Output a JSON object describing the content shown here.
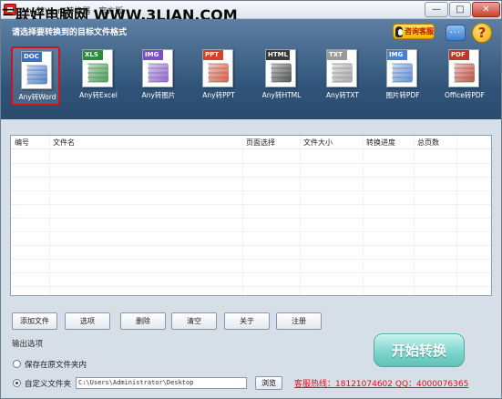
{
  "window": {
    "title": "Any转Word转换器 - 官方版",
    "watermark": "三联好电脑网 WWW.3LIAN.COM",
    "min_glyph": "—",
    "max_glyph": "□",
    "close_glyph": "✕"
  },
  "header": {
    "caption": "请选择要转换到的目标文件格式",
    "qq_label": "咨询客服",
    "chat_glyph": "···",
    "help_glyph": "?"
  },
  "formats": [
    {
      "tag": "DOC",
      "label": "Any转Word",
      "color": "#3b6fbf",
      "icon": "word-doc-icon",
      "selected": true
    },
    {
      "tag": "XLS",
      "label": "Any转Excel",
      "color": "#2e8b3a",
      "icon": "excel-chart-icon",
      "selected": false
    },
    {
      "tag": "IMG",
      "label": "Any转图片",
      "color": "#7f4fbf",
      "icon": "image-icon",
      "selected": false
    },
    {
      "tag": "PPT",
      "label": "Any转PPT",
      "color": "#d2442a",
      "icon": "ppt-slide-icon",
      "selected": false
    },
    {
      "tag": "HTML",
      "label": "Any转HTML",
      "color": "#3a3a3a",
      "icon": "globe-icon",
      "selected": false
    },
    {
      "tag": "TXT",
      "label": "Any转TXT",
      "color": "#9a9a9a",
      "icon": "text-doc-icon",
      "selected": false
    },
    {
      "tag": "IMG",
      "label": "图片转PDF",
      "color": "#4a7fc9",
      "icon": "image-to-pdf-icon",
      "selected": false
    },
    {
      "tag": "PDF",
      "label": "Office转PDF",
      "color": "#b83a2a",
      "icon": "pdf-icon",
      "selected": false
    }
  ],
  "table": {
    "columns": [
      "编号",
      "文件名",
      "页面选择",
      "文件大小",
      "转换进度",
      "总页数"
    ]
  },
  "buttons": {
    "add_file": "添加文件",
    "options": "选项",
    "delete": "删除",
    "clear": "清空",
    "about": "关于",
    "register": "注册"
  },
  "output": {
    "section_label": "输出选项",
    "save_original": "保存在原文件夹内",
    "custom_folder": "自定义文件夹",
    "path_value": "C:\\Users\\Administrator\\Desktop",
    "browse": "浏览",
    "selected_option": "custom_folder"
  },
  "start_button": "开始转换",
  "hotline": {
    "prefix": "客服热线：",
    "text": "18121074602 QQ：4000076365"
  }
}
